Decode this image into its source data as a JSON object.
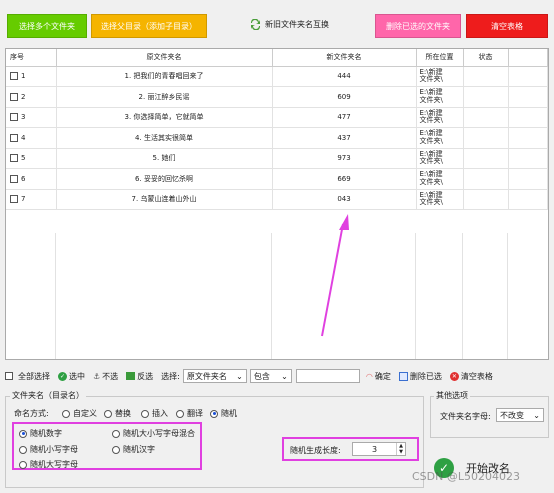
{
  "toolbar": {
    "select_folders": "选择多个文件夹",
    "select_parent": "选择父目录（添加子目录）",
    "swap_names": "新旧文件夹名互换",
    "delete_selected": "删除已选的文件夹",
    "clear_table": "清空表格",
    "colors": {
      "green": "#66cc00",
      "orange": "#f5b400",
      "pink": "#ff66aa",
      "red": "#ee1c1c"
    }
  },
  "table": {
    "headers": [
      "序号",
      "原文件夹名",
      "新文件夹名",
      "所在位置",
      "状态"
    ],
    "rows": [
      {
        "idx": "1",
        "old": "1. 把我们的青春唱回来了",
        "new": "444",
        "loc1": "E:\\新建",
        "loc2": "文件夹\\",
        "status": ""
      },
      {
        "idx": "2",
        "old": "2. 丽江醉乡民谣",
        "new": "609",
        "loc1": "E:\\新建",
        "loc2": "文件夹\\",
        "status": ""
      },
      {
        "idx": "3",
        "old": "3. 你选择简单，它就简单",
        "new": "477",
        "loc1": "E:\\新建",
        "loc2": "文件夹\\",
        "status": ""
      },
      {
        "idx": "4",
        "old": "4. 生活其实很简单",
        "new": "437",
        "loc1": "E:\\新建",
        "loc2": "文件夹\\",
        "status": ""
      },
      {
        "idx": "5",
        "old": "5. 她们",
        "new": "973",
        "loc1": "E:\\新建",
        "loc2": "文件夹\\",
        "status": ""
      },
      {
        "idx": "6",
        "old": "6. 妥妥的回忆杀啊",
        "new": "669",
        "loc1": "E:\\新建",
        "loc2": "文件夹\\",
        "status": ""
      },
      {
        "idx": "7",
        "old": "7. 乌蒙山连着山外山",
        "new": "043",
        "loc1": "E:\\新建",
        "loc2": "文件夹\\",
        "status": ""
      }
    ]
  },
  "actions": {
    "select_all": "全部选择",
    "select_checked": "选中",
    "unselect": "不选",
    "invert": "反选",
    "choose_label": "选择:",
    "field_value": "原文件夹名",
    "match_value": "包含",
    "keyword_value": "",
    "confirm": "确定",
    "delete_selected": "删除已选",
    "clear_table": "清空表格"
  },
  "naming": {
    "group_title": "文件夹名（目录名）",
    "mode_label": "命名方式:",
    "modes": [
      "自定义",
      "替换",
      "插入",
      "翻译",
      "随机"
    ],
    "selected_mode": "随机",
    "random_options": [
      "随机数字",
      "随机大小写字母混合",
      "随机小写字母",
      "随机汉字",
      "随机大写字母"
    ],
    "selected_random": "随机数字",
    "length_label": "随机生成长度:",
    "length_value": "3"
  },
  "other": {
    "group_title": "其他选项",
    "case_label": "文件夹名字母:",
    "case_value": "不改变"
  },
  "start_button": "开始改名",
  "watermark": "CSDN @L50204023",
  "annotation_color": "#e040e0"
}
